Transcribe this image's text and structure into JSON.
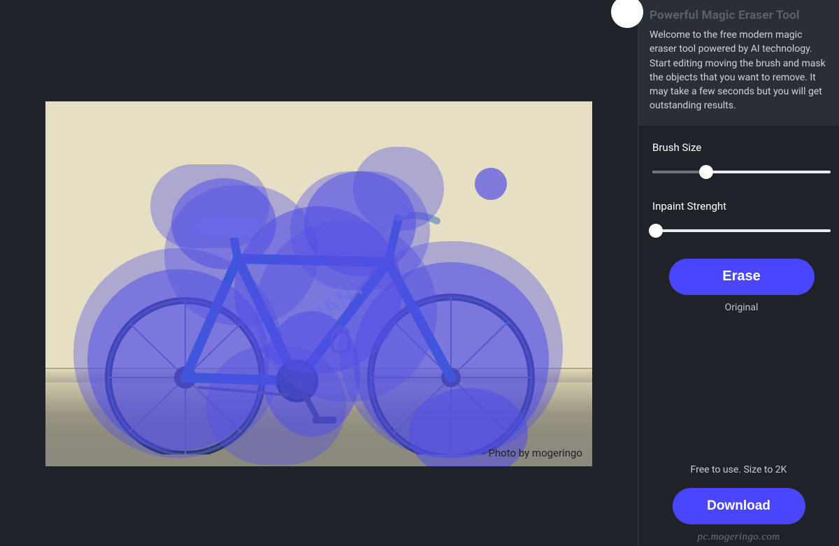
{
  "canvas": {
    "photo_credit": "Photo by mogeringo"
  },
  "sidebar": {
    "info": {
      "title": "Powerful Magic Eraser Tool",
      "description": "Welcome to the free modern magic eraser tool powered by AI technology. Start editing moving the brush and mask the objects that you want to remove. It may take a few seconds but you will get outstanding results."
    },
    "brush": {
      "label": "Brush Size",
      "value_pct": 30
    },
    "inpaint": {
      "label": "Inpaint Strenght",
      "value_pct": 2
    },
    "erase_label": "Erase",
    "original_label": "Original",
    "footer_note": "Free to use. Size to 2K",
    "download_label": "Download",
    "watermark": "pc.mogeringo.com"
  },
  "colors": {
    "accent": "#4a46ff",
    "mask": "rgba(82,79,230,.55)"
  }
}
